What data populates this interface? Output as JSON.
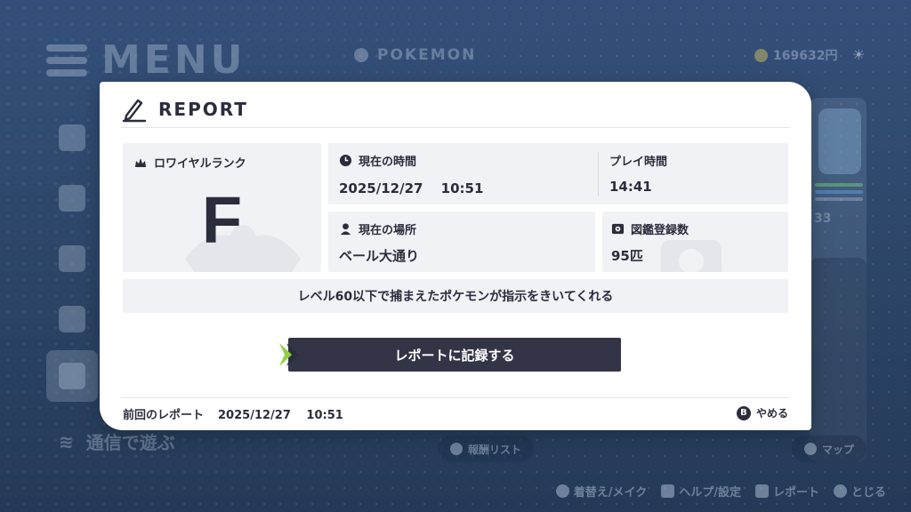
{
  "background": {
    "menu_title": "MENU",
    "tab_label": "POKEMON",
    "money": "169632円",
    "side_text": "通信で遊ぶ",
    "party_count": "33",
    "buttons": [
      {
        "label": "報酬リスト",
        "icon": "x-button-icon"
      },
      {
        "label": "マップ",
        "icon": "plus-button-icon"
      }
    ],
    "footer_keys": [
      {
        "key": "-",
        "label": "着替え/メイク"
      },
      {
        "key": "L",
        "label": "ヘルプ/設定"
      },
      {
        "key": "R",
        "label": "レポート"
      },
      {
        "key": "B",
        "label": "とじる"
      }
    ]
  },
  "dialog": {
    "title": "REPORT",
    "rank": {
      "label": "ロワイヤルランク",
      "value": "F"
    },
    "current_time": {
      "label": "現在の時間",
      "value": "2025/12/27　 10:51"
    },
    "play_time": {
      "label": "プレイ時間",
      "value": "14:41"
    },
    "location": {
      "label": "現在の場所",
      "value": "ベール大通り"
    },
    "pokedex": {
      "label": "図鑑登録数",
      "value": "95匹"
    },
    "info": "レベル60以下で捕まえたポケモンが指示をきいてくれる",
    "save_button": "レポートに記録する",
    "last_report": {
      "label": "前回のレポート",
      "value": "2025/12/27　 10:51"
    },
    "cancel": {
      "key": "B",
      "label": "やめる"
    }
  },
  "colors": {
    "dialog_bg": "#ffffff",
    "card_bg": "#f1f2f5",
    "text": "#2b2d3d",
    "button_bg": "#343447",
    "accent_green": "#8fd13f"
  }
}
